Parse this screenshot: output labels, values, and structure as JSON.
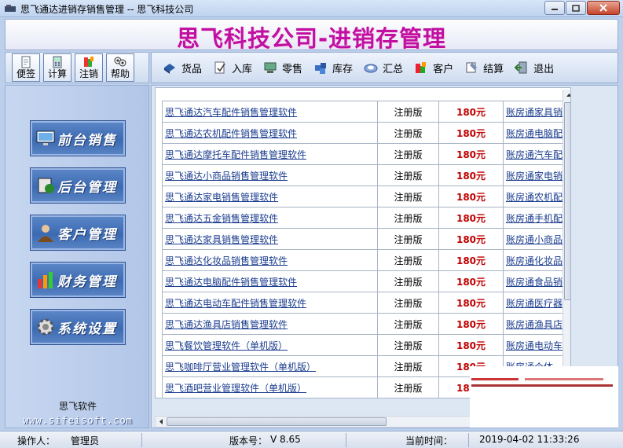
{
  "window": {
    "title": "思飞通达进销存销售管理 -- 思飞科技公司"
  },
  "banner": {
    "title": "思飞科技公司-进销存管理"
  },
  "left_toolbar": [
    {
      "label": "便签",
      "icon": "notepad-icon"
    },
    {
      "label": "计算",
      "icon": "calculator-icon"
    },
    {
      "label": "注销",
      "icon": "logoff-icon"
    },
    {
      "label": "帮助",
      "icon": "help-icon"
    }
  ],
  "main_toolbar": [
    {
      "label": "货品",
      "icon": "goods-icon"
    },
    {
      "label": "入库",
      "icon": "stock-in-icon"
    },
    {
      "label": "零售",
      "icon": "retail-icon"
    },
    {
      "label": "库存",
      "icon": "inventory-icon"
    },
    {
      "label": "汇总",
      "icon": "summary-icon"
    },
    {
      "label": "客户",
      "icon": "customer-icon"
    },
    {
      "label": "结算",
      "icon": "settlement-icon"
    },
    {
      "label": "退出",
      "icon": "exit-icon"
    }
  ],
  "sidebar": {
    "items": [
      {
        "label": "前台销售",
        "icon": "monitor-icon"
      },
      {
        "label": "后台管理",
        "icon": "backoffice-icon"
      },
      {
        "label": "客户管理",
        "icon": "person-icon"
      },
      {
        "label": "财务管理",
        "icon": "finance-chart-icon"
      },
      {
        "label": "系统设置",
        "icon": "gear-icon"
      }
    ],
    "brand_name": "思飞软件",
    "brand_url": "www.sifeisoft.com"
  },
  "products": [
    {
      "name": "思飞通达汽车配件销售管理软件",
      "edition": "注册版",
      "price": "180元",
      "related": "账房通家具销"
    },
    {
      "name": "思飞通达农机配件销售管理软件",
      "edition": "注册版",
      "price": "180元",
      "related": "账房通电脑配"
    },
    {
      "name": "思飞通达摩托车配件销售管理软件",
      "edition": "注册版",
      "price": "180元",
      "related": "账房通汽车配"
    },
    {
      "name": "思飞通达小商品销售管理软件",
      "edition": "注册版",
      "price": "180元",
      "related": "账房通家电销"
    },
    {
      "name": "思飞通达家电销售管理软件",
      "edition": "注册版",
      "price": "180元",
      "related": "账房通农机配"
    },
    {
      "name": "思飞通达五金销售管理软件",
      "edition": "注册版",
      "price": "180元",
      "related": "账房通手机配"
    },
    {
      "name": "思飞通达家具销售管理软件",
      "edition": "注册版",
      "price": "180元",
      "related": "账房通小商品"
    },
    {
      "name": "思飞通达化妆品销售管理软件",
      "edition": "注册版",
      "price": "180元",
      "related": "账房通化妆品"
    },
    {
      "name": "思飞通达电脑配件销售管理软件",
      "edition": "注册版",
      "price": "180元",
      "related": "账房通食品销"
    },
    {
      "name": "思飞通达电动车配件销售管理软件",
      "edition": "注册版",
      "price": "180元",
      "related": "账房通医疗器"
    },
    {
      "name": "思飞通达渔具店销售管理软件",
      "edition": "注册版",
      "price": "180元",
      "related": "账房通渔具店"
    },
    {
      "name": "思飞餐饮管理软件（单机版）",
      "edition": "注册版",
      "price": "180元",
      "related": "账房通电动车"
    },
    {
      "name": "思飞咖啡厅营业管理软件（单机版）",
      "edition": "注册版",
      "price": "180元",
      "related": "账房通个体"
    },
    {
      "name": "思飞酒吧营业管理软件（单机版）",
      "edition": "注册版",
      "price": "180元",
      "related": "账房通"
    }
  ],
  "statusbar": {
    "operator_label": "操作人：",
    "operator_value": "管理员",
    "version_label": "版本号：",
    "version_value": "V 8.65",
    "time_label": "当前时间：",
    "time_value": "2019-04-02 11:33:26"
  }
}
